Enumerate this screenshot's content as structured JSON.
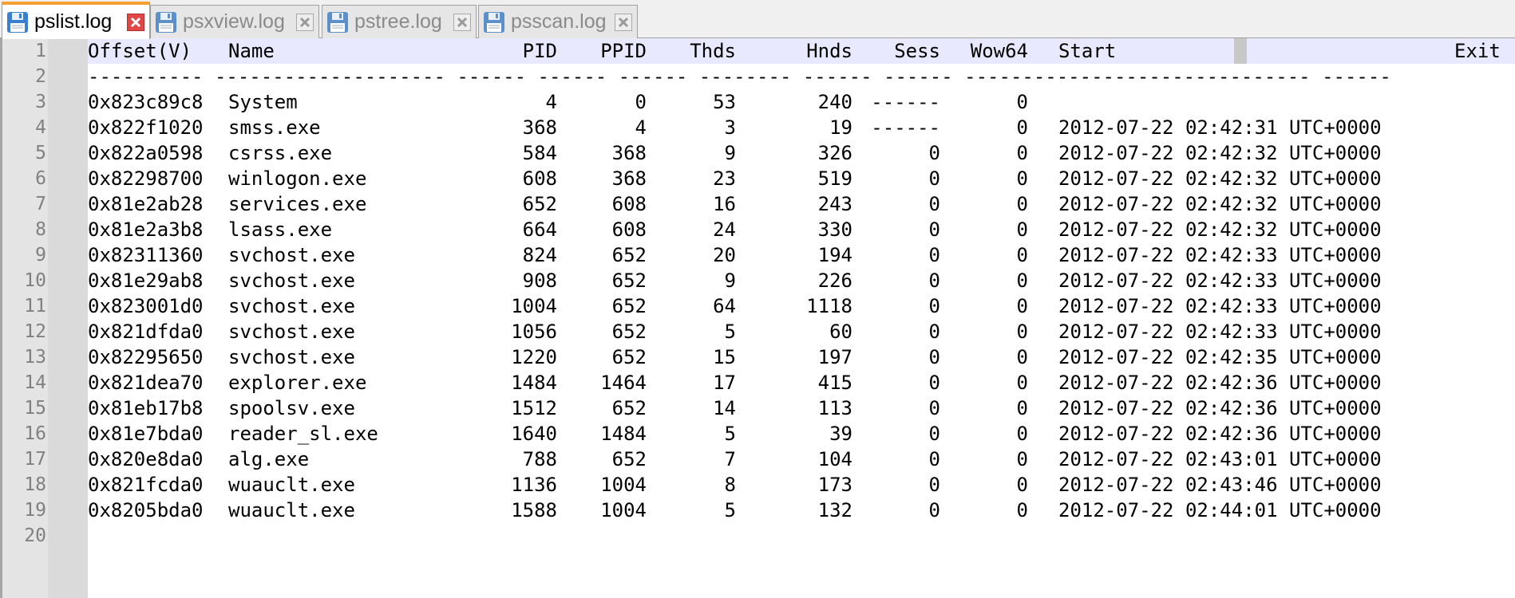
{
  "tabs": [
    {
      "label": "pslist.log",
      "active": true
    },
    {
      "label": "psxview.log",
      "active": false
    },
    {
      "label": "pstree.log",
      "active": false
    },
    {
      "label": "psscan.log",
      "active": false
    }
  ],
  "colors": {
    "accent_tab": "#f5a030",
    "close_active": "#e04848",
    "current_line": "#e8e8ff",
    "floppy": "#3b7fd0"
  },
  "header": {
    "offset": "Offset(V)",
    "name": "Name",
    "pid": "PID",
    "ppid": "PPID",
    "thds": "Thds",
    "hnds": "Hnds",
    "sess": "Sess",
    "wow64": "Wow64",
    "start": "Start",
    "exit": "Exit"
  },
  "separator": "---------- -------------------- ------ ------ ------ -------- ------ ------ ------------------------------ ------",
  "rows": [
    {
      "offset": "0x823c89c8",
      "name": "System",
      "pid": "4",
      "ppid": "0",
      "thds": "53",
      "hnds": "240",
      "sess": "------",
      "wow64": "0",
      "start": ""
    },
    {
      "offset": "0x822f1020",
      "name": "smss.exe",
      "pid": "368",
      "ppid": "4",
      "thds": "3",
      "hnds": "19",
      "sess": "------",
      "wow64": "0",
      "start": "2012-07-22 02:42:31 UTC+0000"
    },
    {
      "offset": "0x822a0598",
      "name": "csrss.exe",
      "pid": "584",
      "ppid": "368",
      "thds": "9",
      "hnds": "326",
      "sess": "0",
      "wow64": "0",
      "start": "2012-07-22 02:42:32 UTC+0000"
    },
    {
      "offset": "0x82298700",
      "name": "winlogon.exe",
      "pid": "608",
      "ppid": "368",
      "thds": "23",
      "hnds": "519",
      "sess": "0",
      "wow64": "0",
      "start": "2012-07-22 02:42:32 UTC+0000"
    },
    {
      "offset": "0x81e2ab28",
      "name": "services.exe",
      "pid": "652",
      "ppid": "608",
      "thds": "16",
      "hnds": "243",
      "sess": "0",
      "wow64": "0",
      "start": "2012-07-22 02:42:32 UTC+0000"
    },
    {
      "offset": "0x81e2a3b8",
      "name": "lsass.exe",
      "pid": "664",
      "ppid": "608",
      "thds": "24",
      "hnds": "330",
      "sess": "0",
      "wow64": "0",
      "start": "2012-07-22 02:42:32 UTC+0000"
    },
    {
      "offset": "0x82311360",
      "name": "svchost.exe",
      "pid": "824",
      "ppid": "652",
      "thds": "20",
      "hnds": "194",
      "sess": "0",
      "wow64": "0",
      "start": "2012-07-22 02:42:33 UTC+0000"
    },
    {
      "offset": "0x81e29ab8",
      "name": "svchost.exe",
      "pid": "908",
      "ppid": "652",
      "thds": "9",
      "hnds": "226",
      "sess": "0",
      "wow64": "0",
      "start": "2012-07-22 02:42:33 UTC+0000"
    },
    {
      "offset": "0x823001d0",
      "name": "svchost.exe",
      "pid": "1004",
      "ppid": "652",
      "thds": "64",
      "hnds": "1118",
      "sess": "0",
      "wow64": "0",
      "start": "2012-07-22 02:42:33 UTC+0000"
    },
    {
      "offset": "0x821dfda0",
      "name": "svchost.exe",
      "pid": "1056",
      "ppid": "652",
      "thds": "5",
      "hnds": "60",
      "sess": "0",
      "wow64": "0",
      "start": "2012-07-22 02:42:33 UTC+0000"
    },
    {
      "offset": "0x82295650",
      "name": "svchost.exe",
      "pid": "1220",
      "ppid": "652",
      "thds": "15",
      "hnds": "197",
      "sess": "0",
      "wow64": "0",
      "start": "2012-07-22 02:42:35 UTC+0000"
    },
    {
      "offset": "0x821dea70",
      "name": "explorer.exe",
      "pid": "1484",
      "ppid": "1464",
      "thds": "17",
      "hnds": "415",
      "sess": "0",
      "wow64": "0",
      "start": "2012-07-22 02:42:36 UTC+0000"
    },
    {
      "offset": "0x81eb17b8",
      "name": "spoolsv.exe",
      "pid": "1512",
      "ppid": "652",
      "thds": "14",
      "hnds": "113",
      "sess": "0",
      "wow64": "0",
      "start": "2012-07-22 02:42:36 UTC+0000"
    },
    {
      "offset": "0x81e7bda0",
      "name": "reader_sl.exe",
      "pid": "1640",
      "ppid": "1484",
      "thds": "5",
      "hnds": "39",
      "sess": "0",
      "wow64": "0",
      "start": "2012-07-22 02:42:36 UTC+0000"
    },
    {
      "offset": "0x820e8da0",
      "name": "alg.exe",
      "pid": "788",
      "ppid": "652",
      "thds": "7",
      "hnds": "104",
      "sess": "0",
      "wow64": "0",
      "start": "2012-07-22 02:43:01 UTC+0000"
    },
    {
      "offset": "0x821fcda0",
      "name": "wuauclt.exe",
      "pid": "1136",
      "ppid": "1004",
      "thds": "8",
      "hnds": "173",
      "sess": "0",
      "wow64": "0",
      "start": "2012-07-22 02:43:46 UTC+0000"
    },
    {
      "offset": "0x8205bda0",
      "name": "wuauclt.exe",
      "pid": "1588",
      "ppid": "1004",
      "thds": "5",
      "hnds": "132",
      "sess": "0",
      "wow64": "0",
      "start": "2012-07-22 02:44:01 UTC+0000"
    }
  ],
  "line_numbers": [
    "1",
    "2",
    "3",
    "4",
    "5",
    "6",
    "7",
    "8",
    "9",
    "10",
    "11",
    "12",
    "13",
    "14",
    "15",
    "16",
    "17",
    "18",
    "19",
    "20"
  ]
}
